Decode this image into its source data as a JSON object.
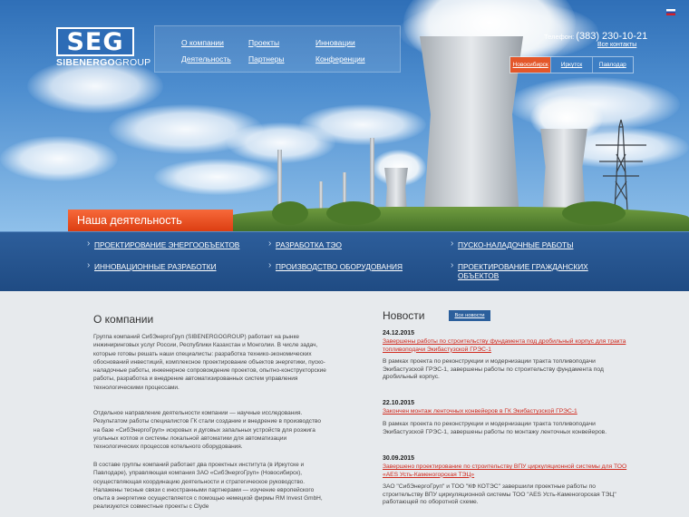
{
  "header": {
    "logo_text": "SEG",
    "logo_sub_bold": "SIBENERGO",
    "logo_sub_rest": "GROUP",
    "nav": [
      {
        "label": "О компании"
      },
      {
        "label": "Проекты"
      },
      {
        "label": "Инновации"
      },
      {
        "label": "Деятельность"
      },
      {
        "label": "Партнеры"
      },
      {
        "label": "Конференции"
      }
    ],
    "phone_label": "Телефон:",
    "phone_number": "(383) 230-10-21",
    "contacts_link": "Все контакты",
    "cities": [
      {
        "label": "Новосибирск",
        "active": true
      },
      {
        "label": "Иркутск",
        "active": false
      },
      {
        "label": "Павлодар",
        "active": false
      }
    ]
  },
  "activity": {
    "title": "Наша деятельность",
    "items": [
      "ПРОЕКТИРОВАНИЕ ЭНЕРГООБЪЕКТОВ",
      "РАЗРАБОТКА ТЭО",
      "ПУСКО-НАЛАДОЧНЫЕ РАБОТЫ",
      "ИННОВАЦИОННЫЕ РАЗРАБОТКИ",
      "ПРОИЗВОДСТВО ОБОРУДОВАНИЯ",
      "ПРОЕКТИРОВАНИЕ ГРАЖДАНСКИХ ОБЪЕКТОВ"
    ]
  },
  "about": {
    "title": "О компании",
    "paragraphs": [
      "Группа компаний СибЭнергоГруп (SIBENERGOGROUP) работает на рынке инжиниринговых услуг России, Республики Казахстан и Монголии. В числе задач, которые готовы решать наши специалисты: разработка технико-экономических обоснований инвестиций, комплексное проектирование объектов энергетики, пуско-наладочные работы, инженерное сопровождение проектов, опытно-конструкторские работы, разработка и внедрение автоматизированных систем управления технологическими процессами.",
      "Отдельное направление деятельности компании — научные исследования. Результатом работы специалистов ГК стали создание и внедрение в производство на базе «СибЭнергоГруп» искровых и дуговых запальных устройств для розжига угольных котлов и системы локальной автоматики для автоматизации технологических процессов котельного оборудования.",
      "В составе группы компаний работает два проектных института (в Иркутске и Павлодаре), управляющая компания ЗАО «СибЭнергоГруп» (Новосибирск), осуществляющая координацию деятельности и стратегическое руководство. Налажены тесные связи с иностранными партнерами — изучение европейского опыта в энергетике осуществляется с помощью немецкой фирмы RM Invest GmbH, реализуются совместные проекты с Clyde"
    ]
  },
  "news": {
    "title": "Новости",
    "all_link": "Все новости",
    "items": [
      {
        "date": "24.12.2015",
        "headline": "Завершены работы по строительству фундамента под дробильный корпус для тракта топливоподачи Экибастузской ГРЭС-1",
        "text": "В рамках проекта по реконструкции и модернизации тракта топливоподачи Экибастузской ГРЭС-1, завершены работы по строительству фундамента под дробильный корпус."
      },
      {
        "date": "22.10.2015",
        "headline": "Закончен монтаж ленточных конвейеров в ГК Экибастузской ГРЭС-1",
        "text": "В рамках проекта по реконструкции и модернизации тракта топливоподачи Экибастузской ГРЭС-1, завершены работы по монтажу ленточных конвейеров."
      },
      {
        "date": "30.09.2015",
        "headline": "Завершено проектирование по строительству ВПУ циркуляционной системы для ТОО «AES Усть-Каменогорская ТЭЦ»",
        "text": "ЗАО \"СибЭнергоГруп\" и ТОО \"КФ КОТЭС\" завершили проектные работы по строительству ВПУ циркуляционной системы ТОО \"AES Усть-Каменогорская ТЭЦ\" работающей по оборотной схеме."
      }
    ]
  }
}
